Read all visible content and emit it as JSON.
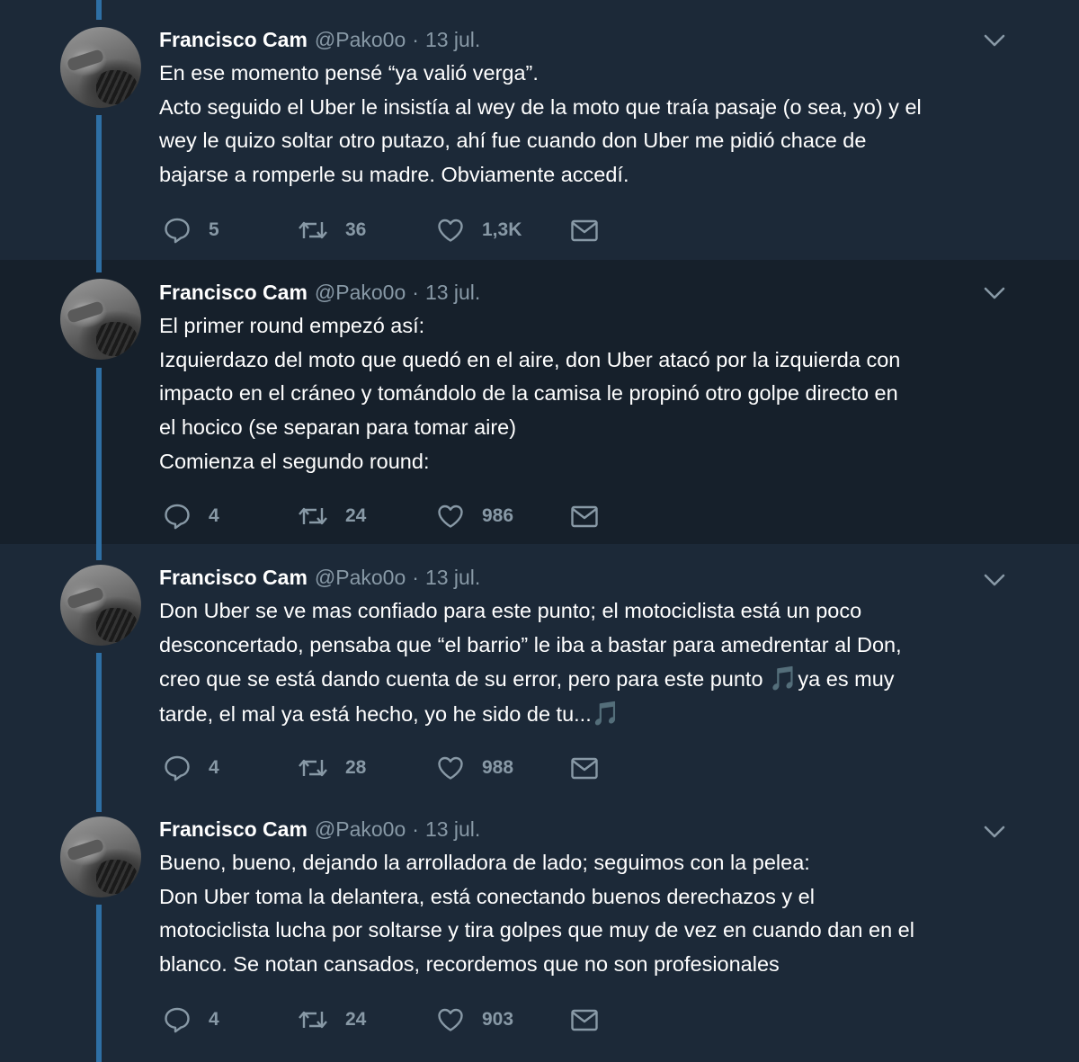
{
  "tweets": [
    {
      "author": "Francisco Cam",
      "handle": "@Pako0o",
      "separator": "·",
      "date": "13 jul.",
      "lines": [
        "En ese momento pensé “ya valió verga”.",
        "Acto seguido el Uber le insistía al wey de la moto que traía pasaje (o sea, yo) y el",
        "wey le quizo soltar otro putazo, ahí fue cuando don Uber me pidió chace de",
        "bajarse a romperle su madre. Obviamente accedí."
      ],
      "replies": "5",
      "retweets": "36",
      "likes": "1,3K"
    },
    {
      "author": "Francisco Cam",
      "handle": "@Pako0o",
      "separator": "·",
      "date": "13 jul.",
      "lines": [
        "El primer round empezó así:",
        "Izquierdazo del moto que quedó en el aire, don Uber atacó por la izquierda con",
        "impacto en el cráneo y tomándolo de la camisa le propinó otro golpe directo en",
        "el hocico (se separan para tomar aire)",
        "Comienza el segundo round:"
      ],
      "replies": "4",
      "retweets": "24",
      "likes": "986"
    },
    {
      "author": "Francisco Cam",
      "handle": "@Pako0o",
      "separator": "·",
      "date": "13 jul.",
      "lines": [
        "Don Uber se ve mas confiado para este punto; el motociclista está un poco",
        "desconcertado, pensaba que “el barrio” le iba a bastar para amedrentar al Don,"
      ],
      "line3_before": "creo que se está dando cuenta de su error, pero para este punto ",
      "line3_after": "ya es muy",
      "line4_before": "tarde, el mal ya está hecho, yo he sido de tu...",
      "music_note": "🎵",
      "replies": "4",
      "retweets": "28",
      "likes": "988"
    },
    {
      "author": "Francisco Cam",
      "handle": "@Pako0o",
      "separator": "·",
      "date": "13 jul.",
      "lines": [
        "Bueno, bueno, dejando la arrolladora de lado; seguimos con la pelea:",
        "Don Uber toma la delantera, está conectando buenos derechazos y el",
        "motociclista lucha por soltarse y tira golpes que muy de vez en cuando dan en el",
        "blanco. Se notan cansados, recordemos que no son profesionales"
      ],
      "replies": "4",
      "retweets": "24",
      "likes": "903"
    }
  ],
  "icons": {
    "reply": "reply-icon",
    "retweet": "retweet-icon",
    "like": "heart-icon",
    "dm": "envelope-icon",
    "menu": "chevron-down-icon"
  },
  "colors": {
    "background": "#1c2938",
    "alt_background": "#16202b",
    "thread_line": "#2e6fa4",
    "muted_text": "#8899a6",
    "accent": "#3fa0e8"
  }
}
